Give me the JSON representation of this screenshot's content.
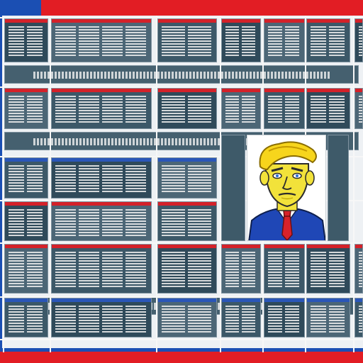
{
  "colors": {
    "red": "#e21d24",
    "blue": "#1b4fb3",
    "tile": "#3c5868",
    "grid": "#f7f7f7",
    "skin": "#f2e23a",
    "hair": "#f7d51c",
    "suit": "#1f47b6",
    "tie": "#d8222a"
  },
  "icons": {
    "portrait": "cartoon-portrait-icon"
  },
  "grid": {
    "rows": [
      {
        "name": "row-1",
        "strip": "red"
      },
      {
        "name": "row-2",
        "strip": "red"
      },
      {
        "name": "row-3",
        "strip": "blue"
      },
      {
        "name": "row-4",
        "strip": "red"
      },
      {
        "name": "row-5",
        "strip": "red"
      },
      {
        "name": "row-6",
        "strip": "blue"
      }
    ]
  }
}
